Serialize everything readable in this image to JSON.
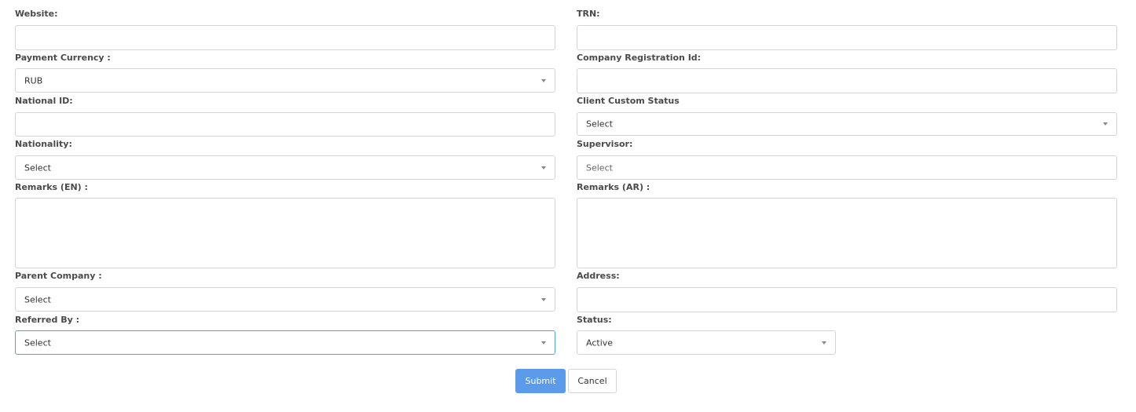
{
  "form": {
    "website": {
      "label": "Website:",
      "value": ""
    },
    "trn": {
      "label": "TRN:",
      "value": ""
    },
    "payment_currency": {
      "label": "Payment Currency :",
      "value": "RUB"
    },
    "company_registration_id": {
      "label": "Company Registration Id:",
      "value": ""
    },
    "national_id": {
      "label": "National ID:",
      "value": ""
    },
    "client_custom_status": {
      "label": "Client Custom Status",
      "value": "Select"
    },
    "nationality": {
      "label": "Nationality:",
      "value": "Select"
    },
    "supervisor": {
      "label": "Supervisor:",
      "placeholder": "Select"
    },
    "remarks_en": {
      "label": "Remarks (EN) :",
      "value": ""
    },
    "remarks_ar": {
      "label": "Remarks (AR) :",
      "value": ""
    },
    "parent_company": {
      "label": "Parent Company :",
      "value": "Select"
    },
    "address": {
      "label": "Address:",
      "value": ""
    },
    "referred_by": {
      "label": "Referred By :",
      "value": "Select"
    },
    "status": {
      "label": "Status:",
      "value": "Active"
    }
  },
  "actions": {
    "submit_label": "Submit",
    "cancel_label": "Cancel"
  },
  "colors": {
    "primary_button": "#5b9bea",
    "focus_border": "#5aa6c0",
    "field_border": "#d5d5d5"
  },
  "icons": {
    "select_caret": "caret-down-icon"
  }
}
